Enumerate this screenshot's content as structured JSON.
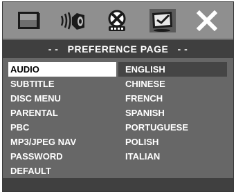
{
  "header": {
    "icons": [
      "general-setup-icon",
      "speaker-setup-icon",
      "dolby-digital-setup-icon",
      "preference-icon",
      "exit-icon"
    ]
  },
  "page": {
    "title": "- -   PREFERENCE PAGE   - -"
  },
  "menu": {
    "items": [
      {
        "label": "AUDIO"
      },
      {
        "label": "SUBTITLE"
      },
      {
        "label": "DISC MENU"
      },
      {
        "label": "PARENTAL"
      },
      {
        "label": "PBC"
      },
      {
        "label": "MP3/JPEG NAV"
      },
      {
        "label": "PASSWORD"
      },
      {
        "label": "DEFAULT"
      }
    ],
    "selected": "AUDIO"
  },
  "options": {
    "items": [
      {
        "label": "ENGLISH"
      },
      {
        "label": "CHINESE"
      },
      {
        "label": "FRENCH"
      },
      {
        "label": "SPANISH"
      },
      {
        "label": "PORTUGUESE"
      },
      {
        "label": "POLISH"
      },
      {
        "label": "ITALIAN"
      }
    ],
    "highlighted": "ENGLISH"
  },
  "colors": {
    "background": "#676767",
    "iconbar": "#8f8f8f",
    "titlebar": "#3f3f3f",
    "highlight": "#454545",
    "text": "#ffffff"
  }
}
